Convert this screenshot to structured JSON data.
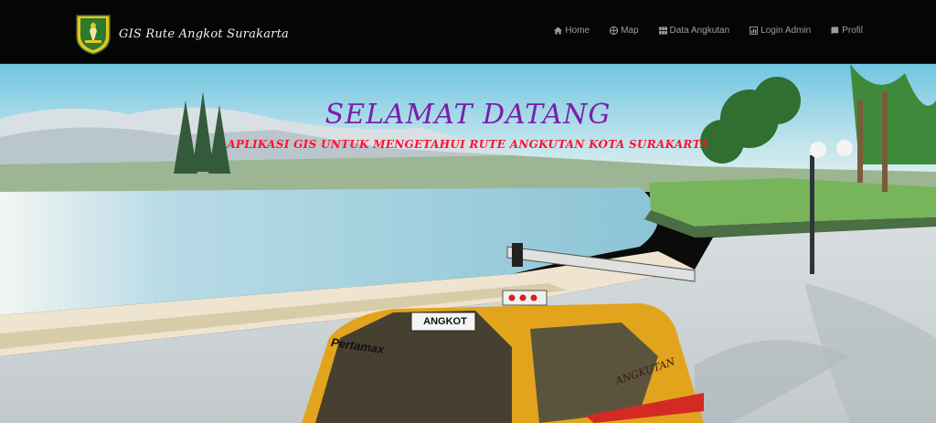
{
  "brand": {
    "title": "GIS Rute Angkot Surakarta",
    "logo_icon": "surakarta-crest-icon"
  },
  "nav": {
    "items": [
      {
        "label": "Home",
        "icon": "home-icon"
      },
      {
        "label": "Map",
        "icon": "globe-icon"
      },
      {
        "label": "Data Angkutan",
        "icon": "grid-icon"
      },
      {
        "label": "Login Admin",
        "icon": "chart-icon"
      },
      {
        "label": "Profil",
        "icon": "book-icon"
      }
    ]
  },
  "hero": {
    "title": "SELAMAT DATANG",
    "subtitle": "APLIKASI GIS UNTUK MENGETAHUI RUTE ANGKUTAN KOTA SURAKARTA",
    "van_sign": "ANGKOT",
    "van_brand": "Pertamax",
    "van_side": "ANGKUTAN"
  },
  "colors": {
    "navbar": "#050505",
    "title": "#7a1eaa",
    "subtitle": "#ff1232",
    "van": "#e2a41c"
  }
}
